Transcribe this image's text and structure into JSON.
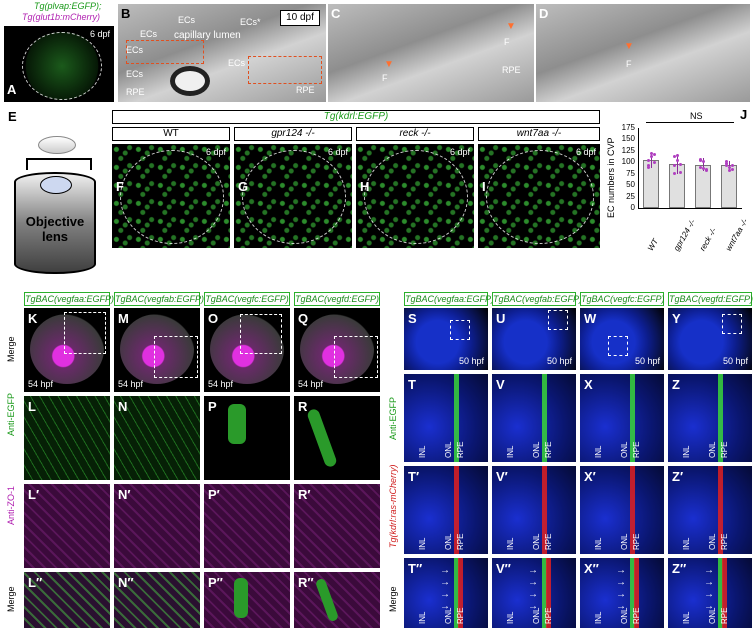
{
  "row1": {
    "A": {
      "label": "A",
      "title_green": "Tg(plvap:EGFP);",
      "title_magenta": "Tg(glut1b:mCherry)",
      "stage": "6 dpf"
    },
    "B": {
      "label": "B",
      "stage": "10 dpf",
      "ecs": [
        "ECs",
        "ECs",
        "ECs",
        "ECs*",
        "ECs",
        "ECs"
      ],
      "lumen": "capillary lumen",
      "rpe": [
        "RPE",
        "RPE"
      ]
    },
    "C": {
      "label": "C",
      "f": [
        "F",
        "F"
      ],
      "rpe": "RPE"
    },
    "D": {
      "label": "D",
      "f": "F"
    }
  },
  "row2": {
    "E": {
      "label": "E",
      "objective": "Objective\nlens"
    },
    "transgene": "Tg(kdrl:EGFP)",
    "genotypes": [
      {
        "label": "F",
        "name": "WT",
        "stage": "6 dpf"
      },
      {
        "label": "G",
        "name": "gpr124 -/-",
        "stage": "6 dpf"
      },
      {
        "label": "H",
        "name": "reck -/-",
        "stage": "6 dpf"
      },
      {
        "label": "I",
        "name": "wnt7aa -/-",
        "stage": "6 dpf"
      }
    ]
  },
  "chart_data": {
    "type": "bar",
    "panel": "J",
    "ylabel": "EC numbers in CVP",
    "categories": [
      "WT",
      "gpr124 -/-",
      "reck -/-",
      "wnt7aa -/-"
    ],
    "values": [
      105,
      97,
      95,
      93
    ],
    "errors": [
      18,
      22,
      14,
      10
    ],
    "ylim": [
      0,
      175
    ],
    "yticks": [
      "0",
      "25",
      "50",
      "75",
      "100",
      "125",
      "150",
      "175"
    ],
    "annotation": "NS"
  },
  "left_block": {
    "headers": [
      "TgBAC(vegfaa:EGFP)",
      "TgBAC(vegfab:EGFP)",
      "TgBAC(vegfc:EGFP)",
      "TgBAC(vegfd:EGFP)"
    ],
    "rows": [
      {
        "side": "Merge",
        "labels": [
          "K",
          "M",
          "O",
          "Q"
        ],
        "stage": "54 hpf"
      },
      {
        "side": "Anti-EGFP",
        "labels": [
          "L",
          "N",
          "P",
          "R"
        ]
      },
      {
        "side": "Anti-ZO-1",
        "labels": [
          "L′",
          "N′",
          "P′",
          "R′"
        ]
      },
      {
        "side": "Merge",
        "labels": [
          "L″",
          "N″",
          "P″",
          "R″"
        ]
      }
    ]
  },
  "right_block": {
    "headers": [
      "TgBAC(vegfaa:EGFP)",
      "TgBAC(vegfab:EGFP)",
      "TgBAC(vegfc:EGFP)",
      "TgBAC(vegfd:EGFP)"
    ],
    "rows": [
      {
        "side": "",
        "labels": [
          "S",
          "U",
          "W",
          "Y"
        ],
        "stage": "50 hpf"
      },
      {
        "side": "Anti-EGFP",
        "labels": [
          "T",
          "V",
          "X",
          "Z"
        ]
      },
      {
        "side": "Tg(kdrl:ras-mCherry)",
        "labels": [
          "T′",
          "V′",
          "X′",
          "Z′"
        ]
      },
      {
        "side": "Merge",
        "labels": [
          "T″",
          "V″",
          "X″",
          "Z″"
        ]
      }
    ],
    "layers": [
      "INL",
      "ONL",
      "RPE"
    ]
  },
  "colors": {
    "egfp": "#39d639",
    "magenta": "#c020c0",
    "dapi": "#1a30d0",
    "mcherry": "#e02020"
  }
}
